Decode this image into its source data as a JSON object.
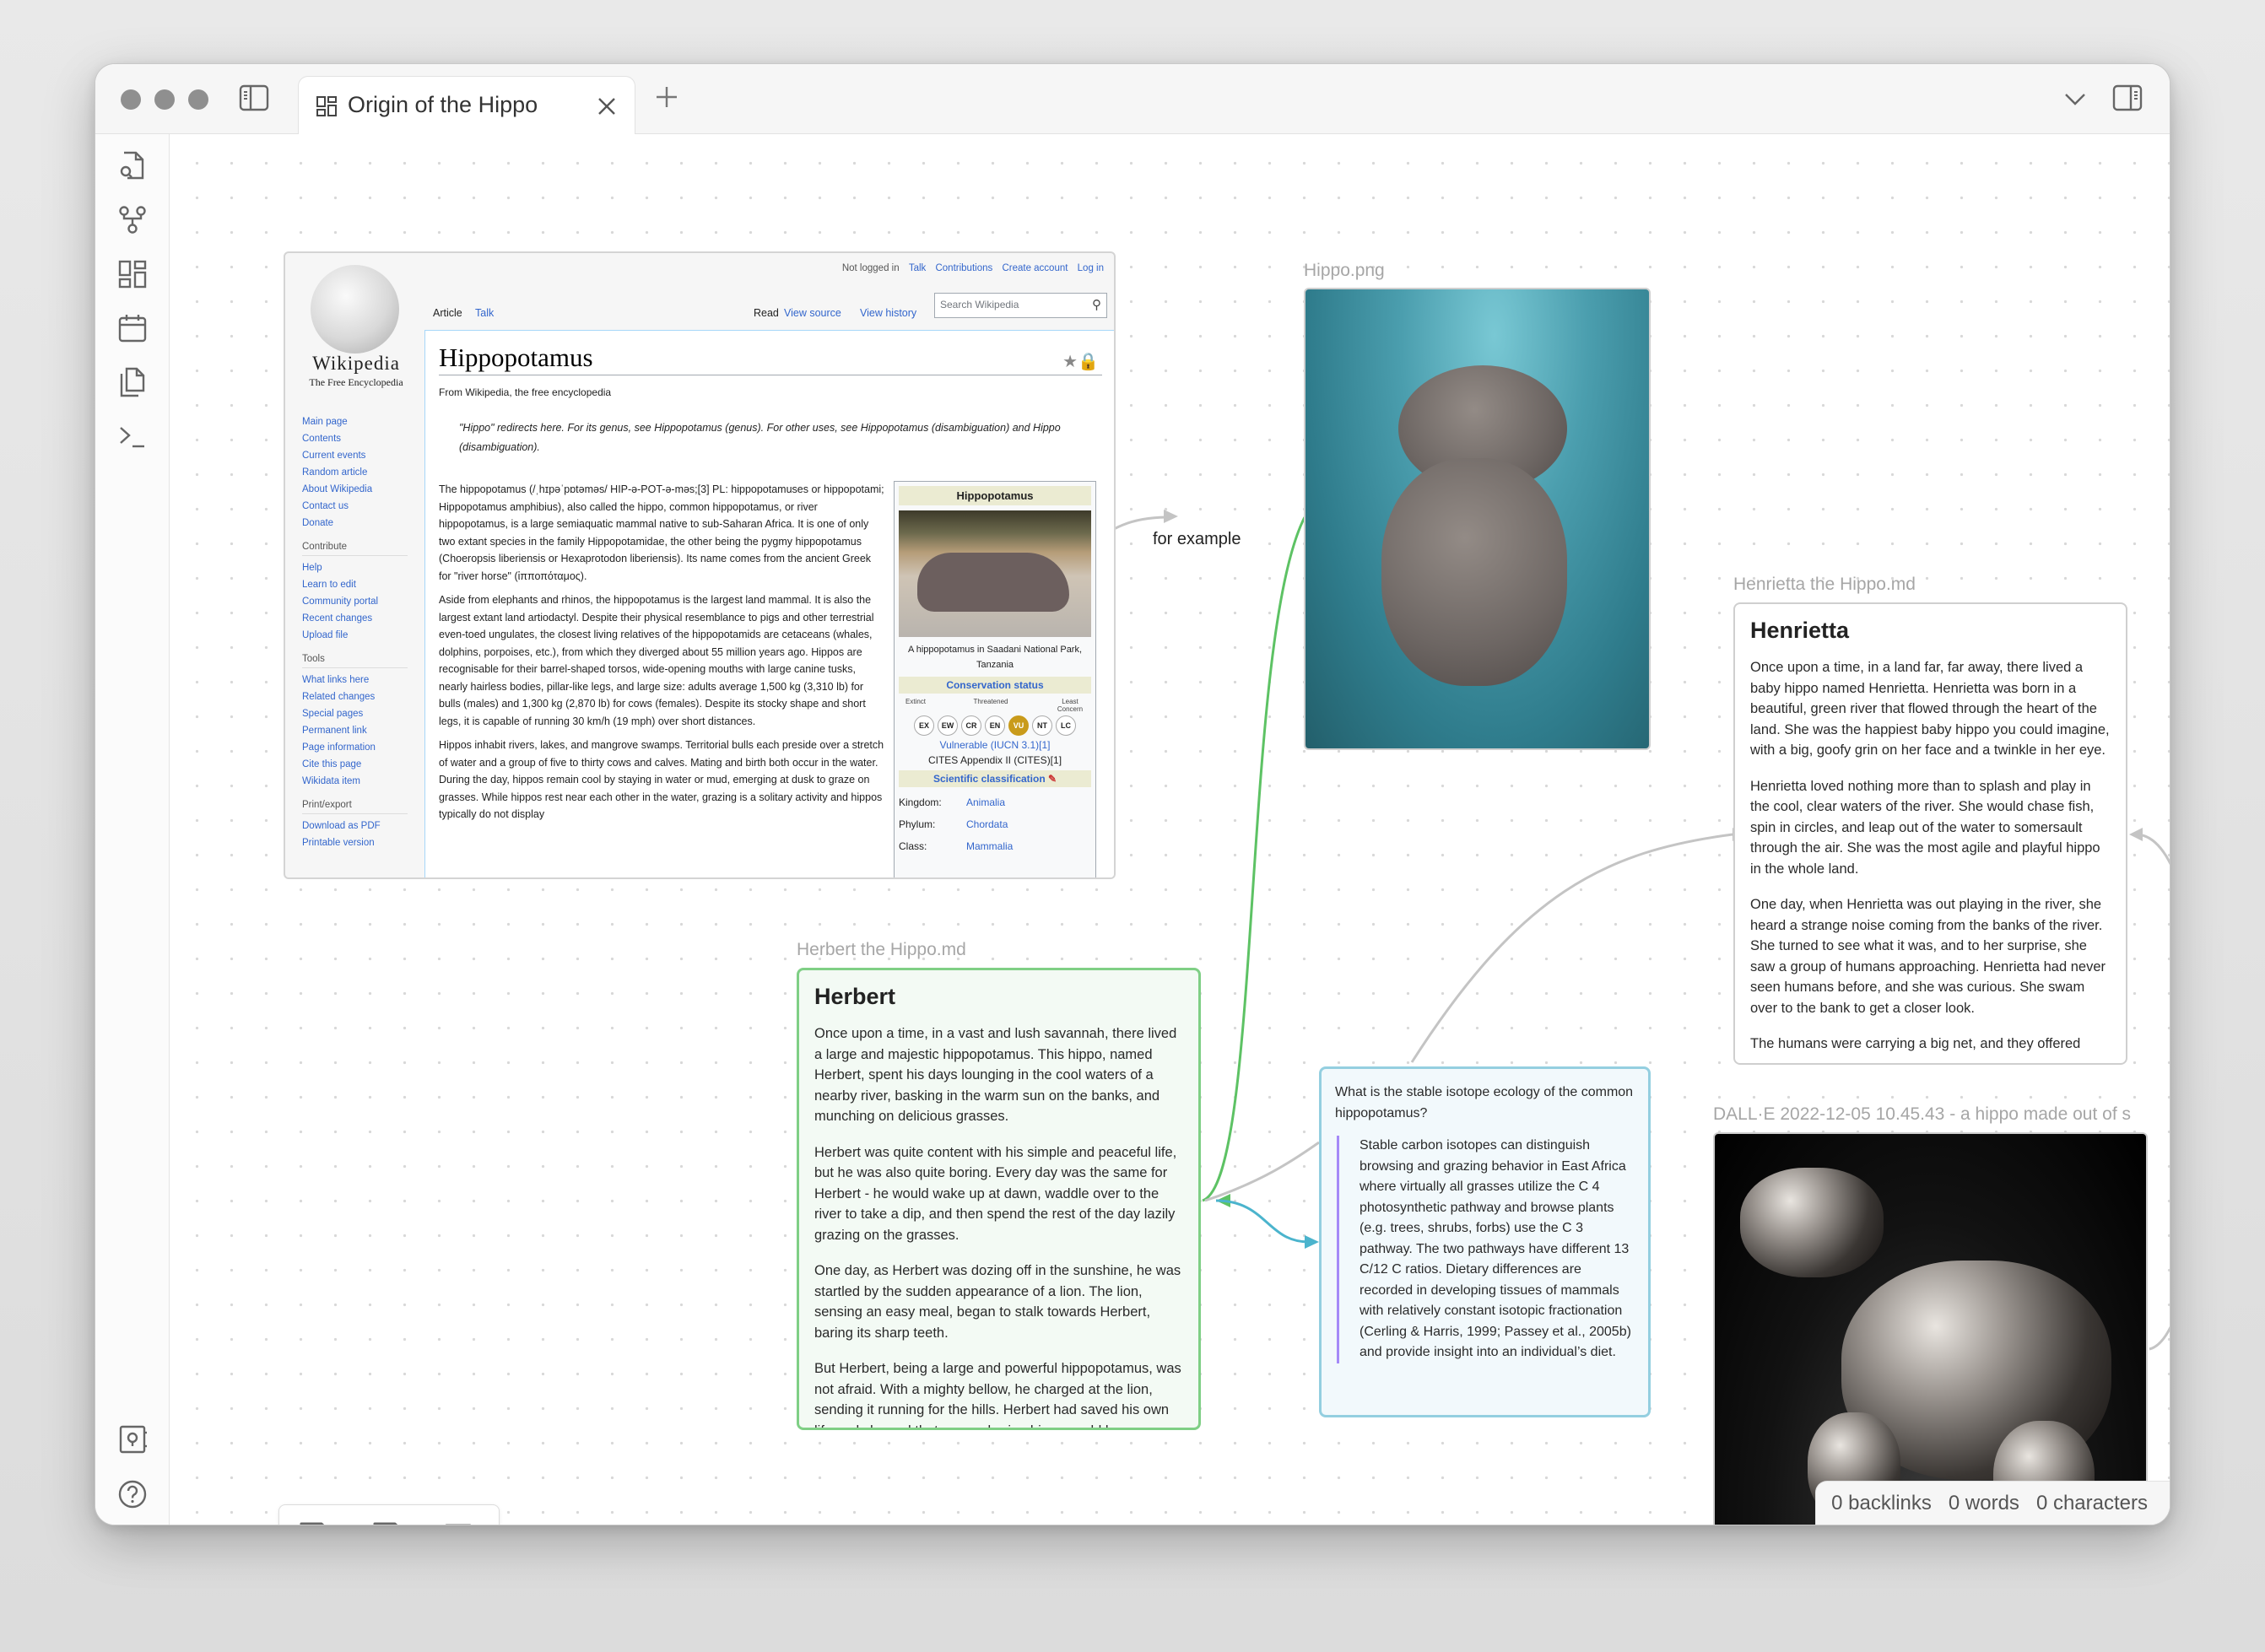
{
  "window": {
    "tab_title": "Origin of the Hippo",
    "tab_icon": "canvas-icon"
  },
  "ribbon": {
    "top_icons": [
      "quick-switcher-icon",
      "graph-view-icon",
      "canvas-icon",
      "daily-note-icon",
      "templates-icon",
      "command-palette-icon"
    ],
    "bottom_icons": [
      "vault-icon",
      "help-icon",
      "settings-icon"
    ]
  },
  "canvas": {
    "edge_label": "for example",
    "wiki": {
      "personal": {
        "user": "Not logged in",
        "talk": "Talk",
        "contributions": "Contributions",
        "create": "Create account",
        "login": "Log in"
      },
      "logo_word": "Wikipedia",
      "logo_tag": "The Free Encyclopedia",
      "tabs": {
        "article": "Article",
        "talk": "Talk",
        "read": "Read",
        "view_source": "View source",
        "view_history": "View history"
      },
      "search_placeholder": "Search Wikipedia",
      "nav_main": [
        "Main page",
        "Contents",
        "Current events",
        "Random article",
        "About Wikipedia",
        "Contact us",
        "Donate"
      ],
      "nav_contribute_heading": "Contribute",
      "nav_contribute": [
        "Help",
        "Learn to edit",
        "Community portal",
        "Recent changes",
        "Upload file"
      ],
      "nav_tools_heading": "Tools",
      "nav_tools": [
        "What links here",
        "Related changes",
        "Special pages",
        "Permanent link",
        "Page information",
        "Cite this page",
        "Wikidata item"
      ],
      "nav_print_heading": "Print/export",
      "nav_print": [
        "Download as PDF",
        "Printable version"
      ],
      "title": "Hippopotamus",
      "from": "From Wikipedia, the free encyclopedia",
      "hatnote": "\"Hippo\" redirects here. For its genus, see Hippopotamus (genus). For other uses, see Hippopotamus (disambiguation) and Hippo (disambiguation).",
      "paragraphs": [
        "The hippopotamus (/ˌhɪpəˈpɒtəməs/ HIP-ə-POT-ə-məs;[3] PL: hippopotamuses or hippopotami; Hippopotamus amphibius), also called the hippo, common hippopotamus, or river hippopotamus, is a large semiaquatic mammal native to sub-Saharan Africa. It is one of only two extant species in the family Hippopotamidae, the other being the pygmy hippopotamus (Choeropsis liberiensis or Hexaprotodon liberiensis). Its name comes from the ancient Greek for \"river horse\" (ἱπποπόταμος).",
        "Aside from elephants and rhinos, the hippopotamus is the largest land mammal. It is also the largest extant land artiodactyl. Despite their physical resemblance to pigs and other terrestrial even-toed ungulates, the closest living relatives of the hippopotamids are cetaceans (whales, dolphins, porpoises, etc.), from which they diverged about 55 million years ago. Hippos are recognisable for their barrel-shaped torsos, wide-opening mouths with large canine tusks, nearly hairless bodies, pillar-like legs, and large size: adults average 1,500 kg (3,310 lb) for bulls (males) and 1,300 kg (2,870 lb) for cows (females). Despite its stocky shape and short legs, it is capable of running 30 km/h (19 mph) over short distances.",
        "Hippos inhabit rivers, lakes, and mangrove swamps. Territorial bulls each preside over a stretch of water and a group of five to thirty cows and calves. Mating and birth both occur in the water. During the day, hippos remain cool by staying in water or mud, emerging at dusk to graze on grasses. While hippos rest near each other in the water, grazing is a solitary activity and hippos typically do not display"
      ],
      "infobox": {
        "title": "Hippopotamus",
        "caption": "A hippopotamus in Saadani National Park, Tanzania",
        "conservation_heading": "Conservation status",
        "scale_labels": {
          "extinct": "Extinct",
          "threatened": "Threatened",
          "least": "Least Concern"
        },
        "statuses": [
          "EX",
          "EW",
          "CR",
          "EN",
          "VU",
          "NT",
          "LC"
        ],
        "active_status": "VU",
        "status_text": "Vulnerable (IUCN 3.1)[1]",
        "cites_text": "CITES Appendix II (CITES)[1]",
        "classification_heading": "Scientific classification",
        "classification": [
          {
            "rank": "Kingdom:",
            "value": "Animalia"
          },
          {
            "rank": "Phylum:",
            "value": "Chordata"
          },
          {
            "rank": "Class:",
            "value": "Mammalia"
          }
        ]
      }
    },
    "hippo_image": {
      "label": "Hippo.png"
    },
    "dalle_image": {
      "label": "DALL·E 2022-12-05 10.45.43 - a hippo made out of s"
    },
    "henrietta": {
      "label": "Henrietta the Hippo.md",
      "heading": "Henrietta",
      "paragraphs": [
        "Once upon a time, in a land far, far away, there lived a baby hippo named Henrietta. Henrietta was born in a beautiful, green river that flowed through the heart of the land. She was the happiest baby hippo you could imagine, with a big, goofy grin on her face and a twinkle in her eye.",
        "Henrietta loved nothing more than to splash and play in the cool, clear waters of the river. She would chase fish, spin in circles, and leap out of the water to somersault through the air. She was the most agile and playful hippo in the whole land.",
        "One day, when Henrietta was out playing in the river, she heard a strange noise coming from the banks of the river. She turned to see what it was, and to her surprise, she saw a group of humans approaching. Henrietta had never seen humans before, and she was curious. She swam over to the bank to get a closer look.",
        "The humans were carrying a big net, and they offered"
      ]
    },
    "herbert": {
      "label": "Herbert the Hippo.md",
      "heading": "Herbert",
      "paragraphs": [
        "Once upon a time, in a vast and lush savannah, there lived a large and majestic hippopotamus. This hippo, named Herbert, spent his days lounging in the cool waters of a nearby river, basking in the warm sun on the banks, and munching on delicious grasses.",
        "Herbert was quite content with his simple and peaceful life, but he was also quite boring. Every day was the same for Herbert - he would wake up at dawn, waddle over to the river to take a dip, and then spend the rest of the day lazily grazing on the grasses.",
        "One day, as Herbert was dozing off in the sunshine, he was startled by the sudden appearance of a lion. The lion, sensing an easy meal, began to stalk towards Herbert, baring its sharp teeth.",
        "But Herbert, being a large and powerful hippopotamus, was not afraid. With a mighty bellow, he charged at the lion, sending it running for the hills. Herbert had saved his own life and showed that even a boring hippo could be"
      ]
    },
    "isotope": {
      "question": "What is the stable isotope ecology of the common hippopotamus?",
      "quote": "Stable carbon isotopes can distinguish browsing and grazing behavior in East Africa where virtually all grasses utilize the C 4 photosynthetic pathway and browse plants (e.g. trees, shrubs, forbs) use the C 3 pathway. The two pathways have different 13 C/12 C ratios. Dietary differences are recorded in developing tissues of mammals with relatively constant isotopic fractionation (Cerling & Harris, 1999; Passey et al., 2005b) and provide insight into an individual’s diet."
    }
  },
  "colors": {
    "green_card": "#7fcf85",
    "green_edge": "#5dc264",
    "cyan_card": "#94cfe0",
    "cyan_edge": "#4bb4cd",
    "gray_edge": "#c4c4c4",
    "quote_bar": "#a58af7",
    "vu_status": "#c99b1b"
  },
  "controls": {
    "zoom_in": "zoom-in-icon",
    "reset_zoom": "fit-view-icon",
    "zoom_out": "zoom-out-icon",
    "snap_grid": "grid-snap-icon",
    "undo": "undo-icon",
    "redo": "redo-icon"
  },
  "bottom_toolbar": [
    "new-note-icon",
    "add-media-icon",
    "new-card-icon"
  ],
  "status_bar": {
    "backlinks": "0 backlinks",
    "words": "0 words",
    "characters": "0 characters"
  }
}
